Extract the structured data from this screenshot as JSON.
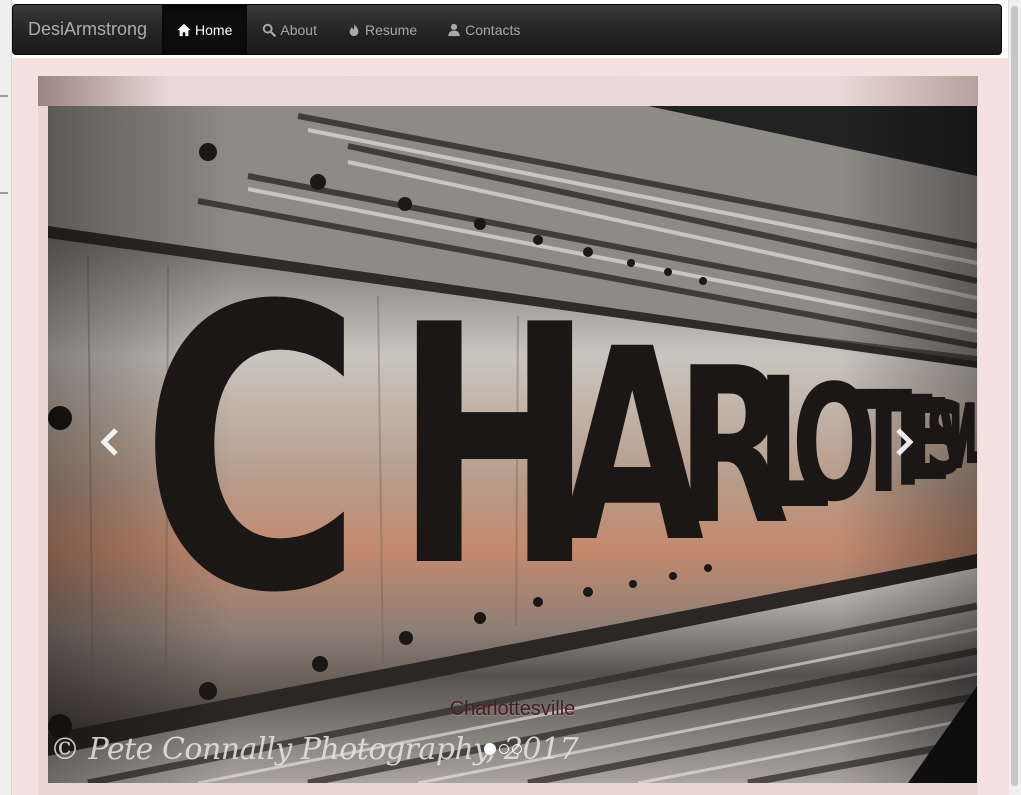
{
  "navbar": {
    "brand": "DesiArmstrong",
    "items": [
      {
        "label": "Home",
        "icon": "home-icon",
        "active": true
      },
      {
        "label": "About",
        "icon": "search-icon",
        "active": false
      },
      {
        "label": "Resume",
        "icon": "fire-icon",
        "active": false
      },
      {
        "label": "Contacts",
        "icon": "user-icon",
        "active": false
      }
    ]
  },
  "carousel": {
    "caption": "Charlottesville",
    "watermark": "© Pete Connally Photography, 2017",
    "slide_count": 3,
    "active_slide": 1,
    "sign_text": "CHARLOTTESVILLE",
    "prev_icon": "chevron-left-icon",
    "next_icon": "chevron-right-icon"
  },
  "colors": {
    "navbar_bg": "#222222",
    "page_bg": "#f3e2df",
    "caption": "#4a1c1c"
  }
}
